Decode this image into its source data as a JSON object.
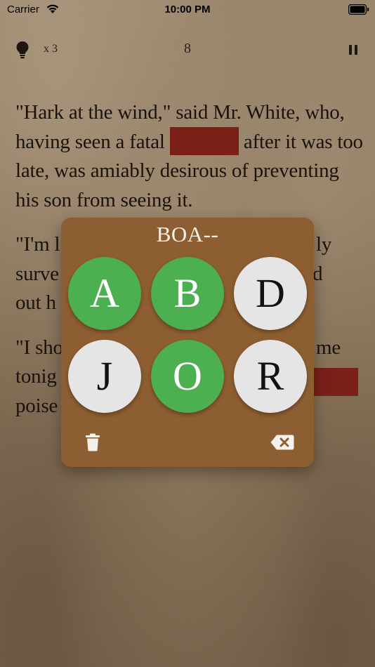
{
  "status_bar": {
    "carrier": "Carrier",
    "time": "10:00 PM",
    "wifi_icon": "wifi-icon",
    "battery_icon": "battery-icon"
  },
  "game_bar": {
    "hint_icon": "lightbulb-icon",
    "hint_count": "x 3",
    "score": "8",
    "pause_icon": "pause-icon"
  },
  "story": {
    "p1_part1": "\"Hark at the wind,\" said Mr. White, who, having seen a fatal ",
    "p1_part2": " after it was too late, was amiably desirous of preventing his son from seeing it.",
    "p2_visible": [
      "\"I'm l",
      "surve",
      "out h"
    ],
    "p2_right": [
      "ly",
      "d"
    ],
    "p3_visible": [
      "\"I sho",
      "tonig",
      "poise"
    ],
    "p3_right": [
      "me"
    ],
    "redacted_color": "#7a2018"
  },
  "guess_panel": {
    "current_guess": "BOA--",
    "letters": [
      {
        "letter": "A",
        "state": "used"
      },
      {
        "letter": "B",
        "state": "used"
      },
      {
        "letter": "D",
        "state": "available"
      },
      {
        "letter": "J",
        "state": "available"
      },
      {
        "letter": "O",
        "state": "used"
      },
      {
        "letter": "R",
        "state": "available"
      }
    ],
    "clear_icon": "trash-icon",
    "backspace_icon": "backspace-icon",
    "used_color": "#4caf50",
    "available_color": "#e5e5e5",
    "panel_color": "#8d5e31"
  }
}
